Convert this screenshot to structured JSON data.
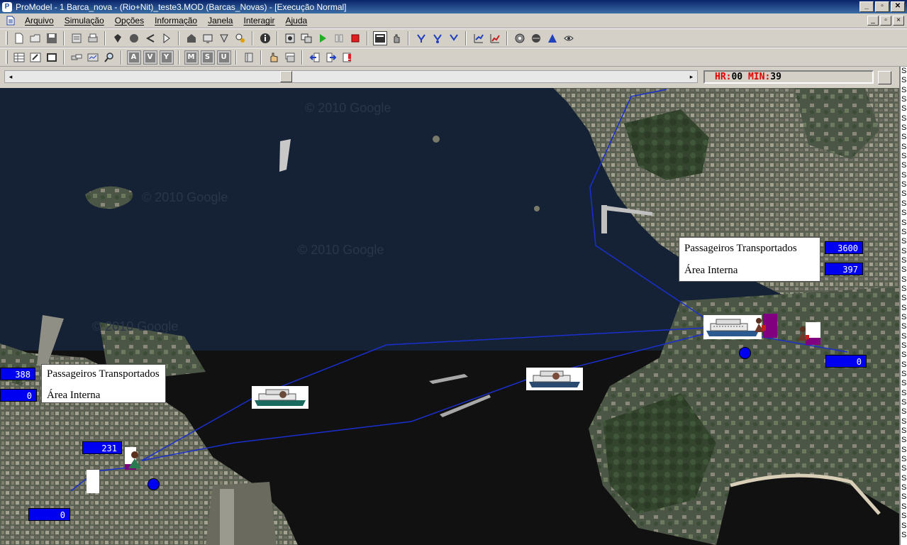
{
  "window": {
    "title": "ProModel - 1 Barca_nova - (Rio+Nit)_teste3.MOD (Barcas_Novas) - [Execução Normal]",
    "minimize": "_",
    "maximize": "▫",
    "close": "✕"
  },
  "menu": {
    "items": [
      "Arquivo",
      "Simulação",
      "Opções",
      "Informação",
      "Janela",
      "Interagir",
      "Ajuda"
    ]
  },
  "clock": {
    "hr_label": "HR:",
    "hr_value": "00",
    "min_label": "MIN:",
    "min_value": "39"
  },
  "toolbar2": {
    "boxed_labels": [
      "A",
      "V",
      "Y",
      "M",
      "S",
      "U"
    ]
  },
  "side_column": {
    "letters": [
      "S",
      "S",
      "S",
      "S",
      "S",
      "S",
      "S",
      "S",
      "S",
      "S",
      "S",
      "S",
      "S",
      "S",
      "S",
      "S",
      "S",
      "S",
      "S",
      "S",
      "S",
      "S",
      "S",
      "S",
      "S",
      "S",
      "S",
      "S",
      "S",
      "S",
      "S",
      "S",
      "S",
      "S",
      "S",
      "S",
      "S",
      "S",
      "S",
      "S",
      "S",
      "S",
      "S",
      "S",
      "S",
      "S",
      "S",
      "S",
      "S",
      "S"
    ]
  },
  "map": {
    "watermark": "© 2010 Google",
    "niteroi_panel": {
      "line1": "Passageiros Transportados",
      "line2": "Área Interna",
      "passengers": "3600",
      "internal": "397",
      "queue": "0"
    },
    "rio_panel": {
      "line1": "Passageiros Transportados",
      "line2": "Área Interna",
      "passengers": "388",
      "internal": "0",
      "dock": "231",
      "queue": "0"
    }
  },
  "colors": {
    "counter_bg": "#0000f0",
    "route_line": "#1a2fcf",
    "dock_purple": "#800080",
    "clock_label": "#e00000"
  }
}
